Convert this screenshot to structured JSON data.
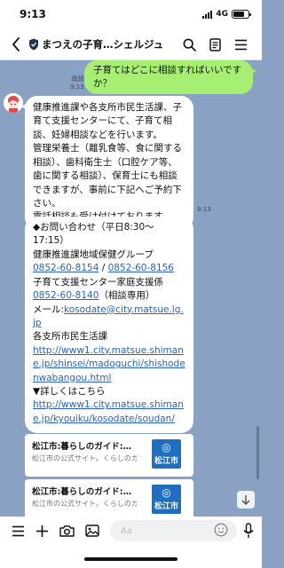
{
  "status_bar": {
    "time": "9:13",
    "network": "4G",
    "battery_level": 0.75
  },
  "header": {
    "title": "まつえの子育…シェルジュ"
  },
  "messages": {
    "user": {
      "text": "子育てはどこに相談すればいいですか？",
      "read": "既読",
      "time": "9:13"
    },
    "bot1": {
      "lines": [
        "健康推進課や各支所市民生活課、子育て支援センターにて、子育て相談、妊婦相談などを行います。",
        "管理栄養士（離乳食等、食に関する相談）、歯科衛生士（口腔ケア等、歯に関する相談）、保育士にも相談できますが、事前に下記へご予約下さい。",
        "電話相談も受け付けております。"
      ],
      "time": "9:13"
    },
    "bot2": {
      "hours": "◆お問い合わせ（平日8:30〜17:15）",
      "group": "健康推進課地域保健グループ",
      "tel1": "0852-60-8154",
      "sep": " / ",
      "tel2": "0852-60-8156",
      "center": "子育て支援センター家庭支援係",
      "tel3": "0852-60-8140",
      "tel3_note": "（相談専用）",
      "mail_label": "メール:",
      "mail": "kosodate@city.matsue.lg.jp",
      "branch": "各支所市民生活課",
      "url1": "http://www1.city.matsue.shimane.jp/shinsei/madoguchi/shishodenwabangou.html",
      "more": "▼詳しくはこちら",
      "url2": "http://www1.city.matsue.shimane.jp/kyouiku/kosodate/soudan/"
    }
  },
  "link_cards": [
    {
      "title": "松江市:暮らしのガイド:…",
      "desc": "松江市の公式サイト。くらしのガイドや事業者向け情報…",
      "logo_text": "松江市"
    },
    {
      "title": "松江市:暮らしのガイド:…",
      "desc": "松江市の公式サイト。くらしのガイドや事業者向け情報…",
      "logo_text": "松江市"
    }
  ],
  "input": {
    "placeholder": "Aa"
  },
  "colors": {
    "chat_bg": "#8ba1c4",
    "user_bubble": "#a7ef73",
    "link": "#2a63b8",
    "logo_bg": "#1f6ec0"
  }
}
